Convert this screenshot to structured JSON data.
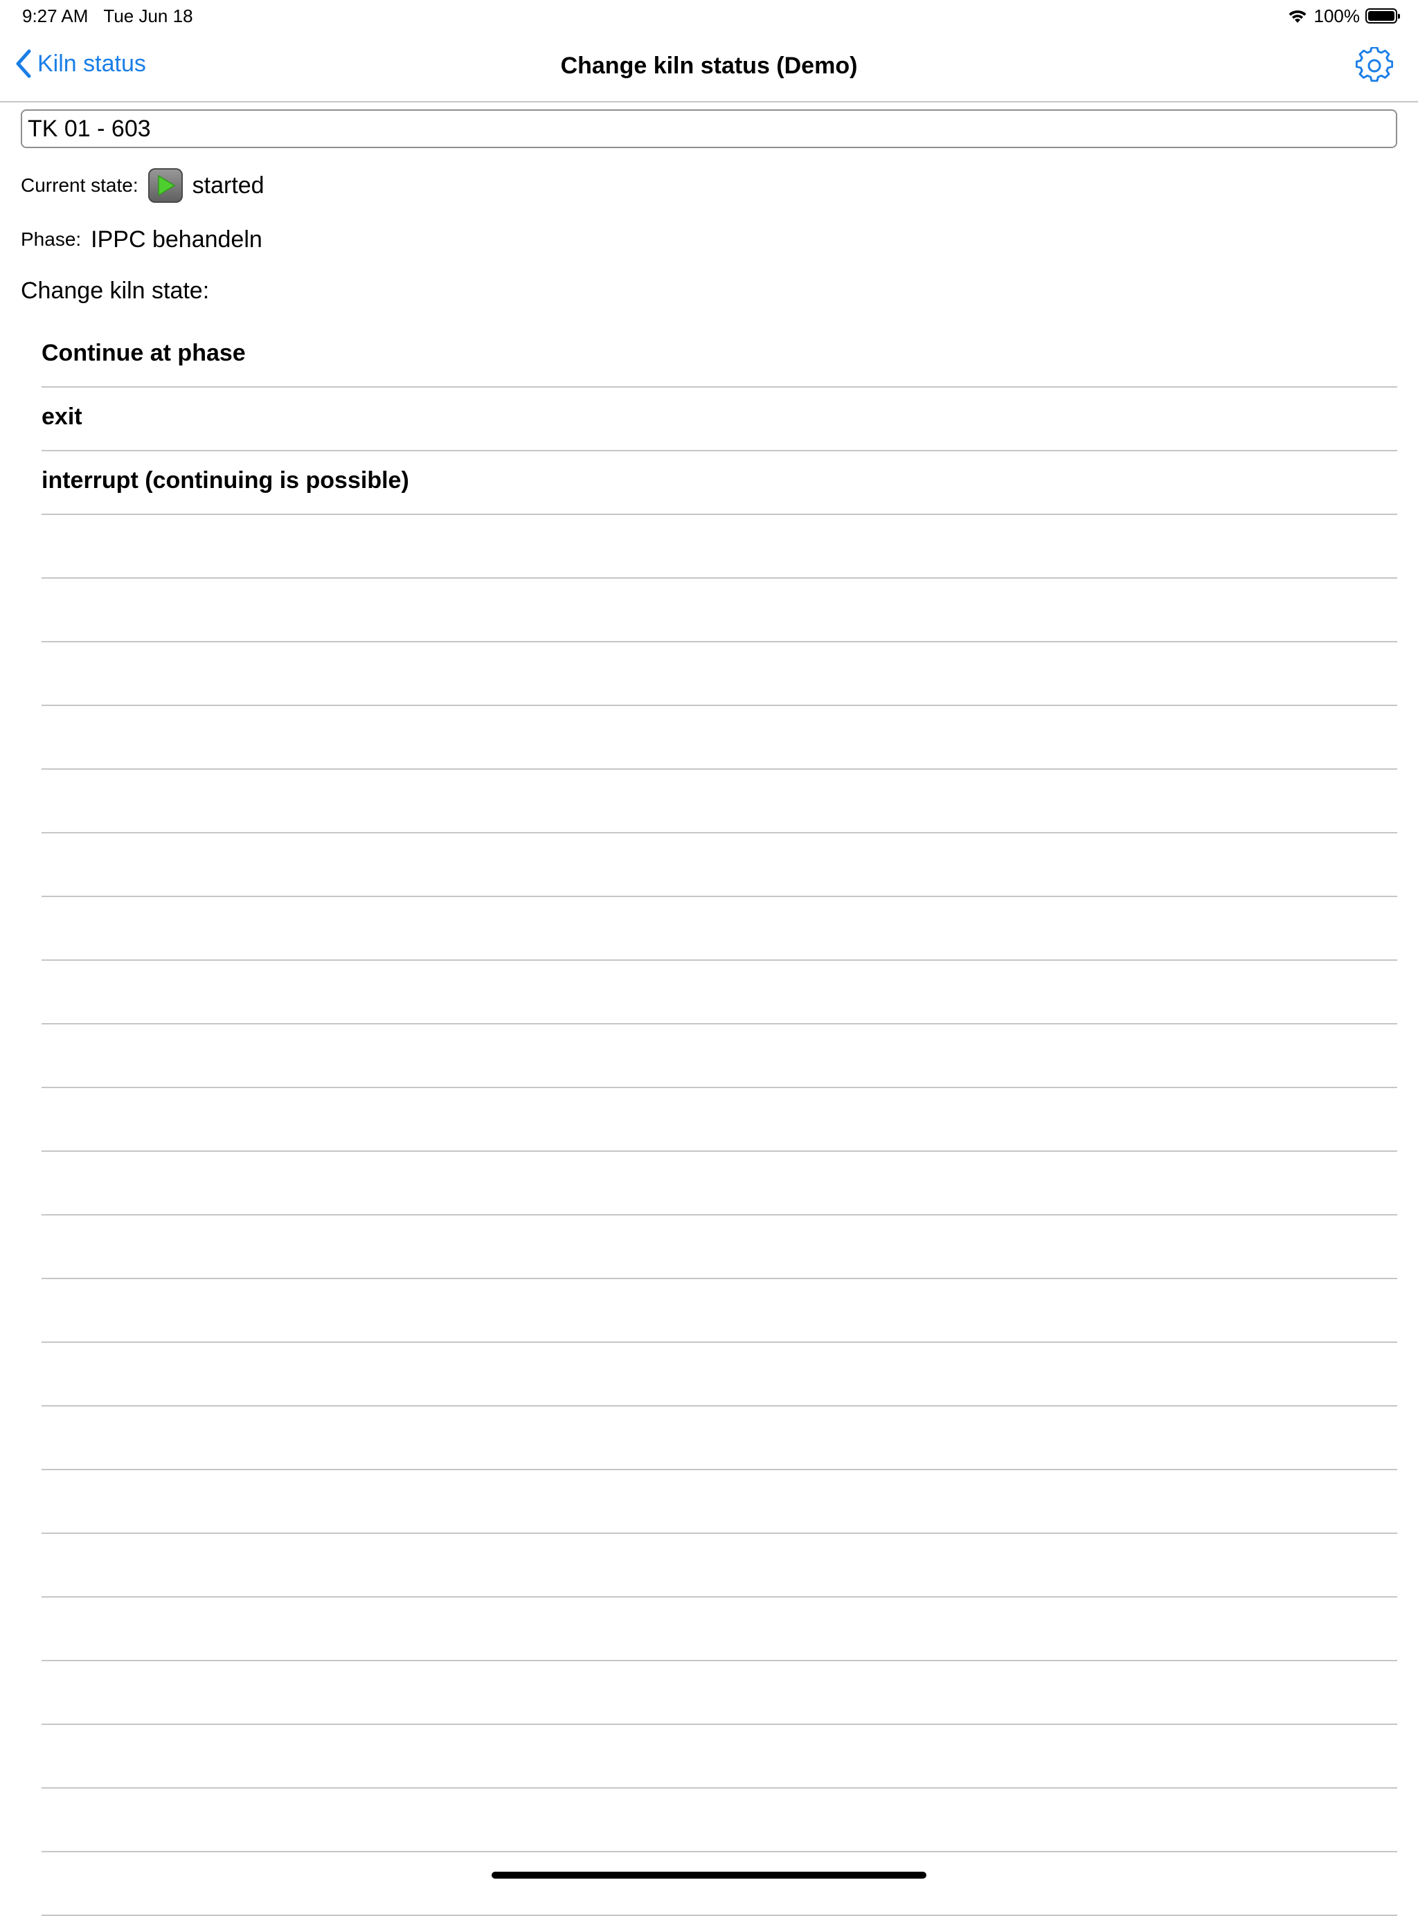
{
  "status_bar": {
    "time": "9:27 AM",
    "date": "Tue Jun 18",
    "battery_text": "100%",
    "wifi_icon": "wifi-icon",
    "battery_icon": "battery-icon"
  },
  "nav": {
    "back_label": "Kiln status",
    "title": "Change kiln status (Demo)",
    "settings_icon": "gear-icon",
    "accent_color": "#1a7ee6"
  },
  "kiln": {
    "name": "TK 01 - 603"
  },
  "current_state": {
    "label": "Current state:",
    "value": "started",
    "icon": "play-icon",
    "icon_color": "#4fcf2f"
  },
  "phase": {
    "label": "Phase:",
    "value": "IPPC behandeln"
  },
  "change": {
    "label": "Change kiln state:"
  },
  "options": [
    {
      "label": "Continue at phase"
    },
    {
      "label": "exit"
    },
    {
      "label": "interrupt (continuing is possible)"
    }
  ]
}
